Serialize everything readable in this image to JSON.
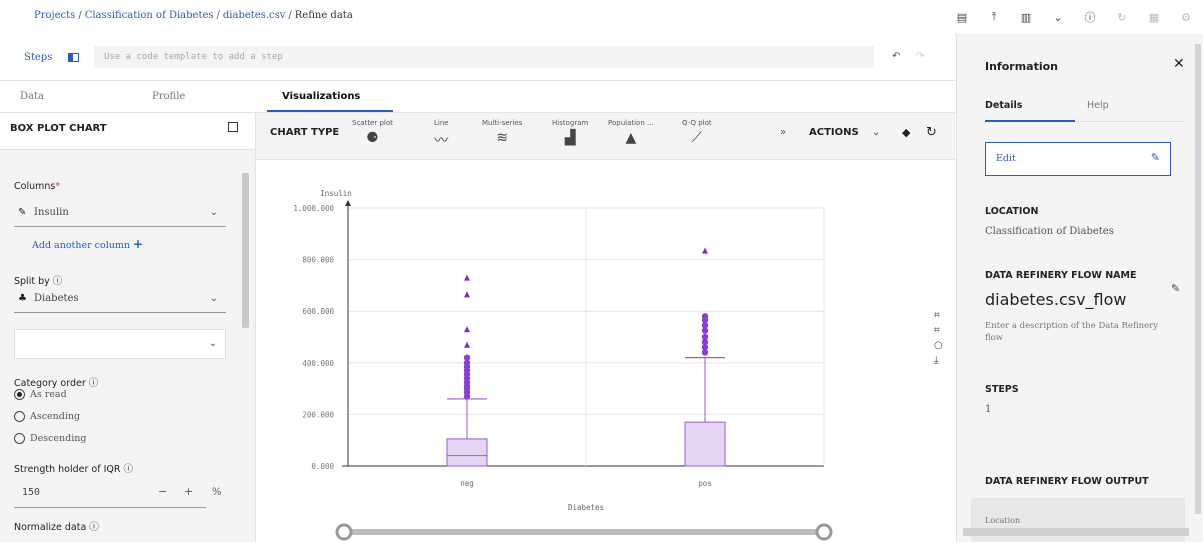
{
  "breadcrumb": {
    "items": [
      "Projects",
      "Classification of Diabetes",
      "diabetes.csv",
      "Refine data"
    ],
    "separator": "/"
  },
  "topbar_icons": [
    "table-icon",
    "upload-icon",
    "view-icon",
    "chevron-down-icon",
    "info-icon",
    "history-icon",
    "grid-icon",
    "settings-icon"
  ],
  "steps": {
    "label": "Steps",
    "placeholder": "Use a code template to add a step"
  },
  "tabs": [
    "Data",
    "Profile",
    "Visualizations"
  ],
  "left_panel": {
    "title": "BOX PLOT CHART",
    "columns_label": "Columns",
    "required_mark": "*",
    "column_value": "Insulin",
    "add_column": "Add another column",
    "split_by_label": "Split by",
    "split_value": "Diabetes",
    "category_order_label": "Category order",
    "category_options": [
      "As read",
      "Ascending",
      "Descending"
    ],
    "selected_category": "As read",
    "iqr_label": "Strength holder of IQR",
    "iqr_value": "150",
    "iqr_unit": "%",
    "normalize_label": "Normalize data"
  },
  "chart_types": {
    "label": "CHART TYPE",
    "items": [
      "Scatter plot",
      "Line",
      "Multi-series",
      "Histogram",
      "Population ...",
      "Q-Q plot"
    ],
    "actions_label": "ACTIONS"
  },
  "chart_data": {
    "type": "box",
    "categories": [
      "neg",
      "pos"
    ],
    "xlabel": "Diabetes",
    "ylabel": "Insulin",
    "ylim": [
      0,
      1000000
    ],
    "yticks": [
      "0.000",
      "200.000",
      "400.000",
      "600.000",
      "800.000",
      "1,000.000"
    ],
    "ytick_values": [
      0,
      200000,
      400000,
      600000,
      800000,
      1000000
    ],
    "boxes": [
      {
        "category": "neg",
        "whisker_low": 0,
        "q1": 0,
        "median": 40000,
        "q3": 105000,
        "whisker_high": 260000,
        "outliers": [
          270000,
          285000,
          300000,
          310000,
          325000,
          340000,
          355000,
          370000,
          385000,
          400000,
          420000,
          470000,
          530000,
          665000,
          730000
        ]
      },
      {
        "category": "pos",
        "whisker_low": 0,
        "q1": 0,
        "median": 0,
        "q3": 170000,
        "whisker_high": 420000,
        "outliers": [
          440000,
          460000,
          480000,
          500000,
          525000,
          545000,
          565000,
          580000,
          835000
        ]
      }
    ],
    "color": "#9b5cd0",
    "grid": true
  },
  "info_panel": {
    "title": "Information",
    "tabs": [
      "Details",
      "Help"
    ],
    "edit_label": "Edit",
    "location_label": "LOCATION",
    "location_value": "Classification of Diabetes",
    "flow_name_label": "DATA REFINERY FLOW NAME",
    "flow_name": "diabetes.csv_flow",
    "flow_desc": "Enter a description of the Data Refinery flow",
    "steps_label": "STEPS",
    "steps_value": "1",
    "output_label": "DATA REFINERY FLOW OUTPUT",
    "output_location": "Location"
  }
}
